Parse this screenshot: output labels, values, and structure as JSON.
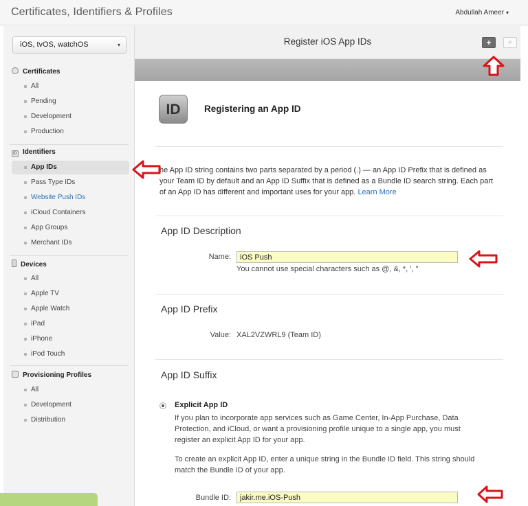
{
  "header": {
    "title": "Certificates, Identifiers & Profiles",
    "user": "Abdullah Ameer",
    "user_caret": "▾"
  },
  "sidebar": {
    "platform": "iOS, tvOS, watchOS",
    "platform_caret": "▾",
    "sections": {
      "certificates": {
        "title": "Certificates",
        "items": [
          "All",
          "Pending",
          "Development",
          "Production"
        ]
      },
      "identifiers": {
        "title": "Identifiers",
        "icon_text": "ID",
        "items": [
          "App IDs",
          "Pass Type IDs",
          "Website Push IDs",
          "iCloud Containers",
          "App Groups",
          "Merchant IDs"
        ]
      },
      "devices": {
        "title": "Devices",
        "items": [
          "All",
          "Apple TV",
          "Apple Watch",
          "iPad",
          "iPhone",
          "iPod Touch"
        ]
      },
      "profiles": {
        "title": "Provisioning Profiles",
        "items": [
          "All",
          "Development",
          "Distribution"
        ]
      }
    }
  },
  "main": {
    "title": "Register iOS App IDs",
    "add_symbol": "+",
    "search_symbol": "⌕",
    "icon_text": "ID",
    "heading": "Registering an App ID",
    "intro": "he App ID string contains two parts separated by a period (.) — an App ID Prefix that is defined as your Team ID by default and an App ID Suffix that is defined as a Bundle ID search string. Each part of an App ID has different and important uses for your app.",
    "learn_more": "Learn More",
    "description": {
      "title": "App ID Description",
      "name_label": "Name:",
      "name_value": "iOS Push",
      "hint": "You cannot use special characters such as @, &, *, ', \""
    },
    "prefix": {
      "title": "App ID Prefix",
      "value_label": "Value:",
      "value": "XAL2VZWRL9 (Team ID)"
    },
    "suffix": {
      "title": "App ID Suffix",
      "explicit_label": "Explicit App ID",
      "explicit_text": "If you plan to incorporate app services such as Game Center, In-App Purchase, Data Protection, and iCloud, or want a provisioning profile unique to a single app, you must register an explicit App ID for your app.",
      "explicit_text2": "To create an explicit App ID, enter a unique string in the Bundle ID field. This string should match the Bundle ID of your app.",
      "bundle_label": "Bundle ID:",
      "bundle_value": "jakir.me.iOS-Push"
    }
  },
  "colors": {
    "annotation_red": "#d8141a",
    "link_blue": "#2d6fb5",
    "input_yellow": "#fbfbc4"
  }
}
